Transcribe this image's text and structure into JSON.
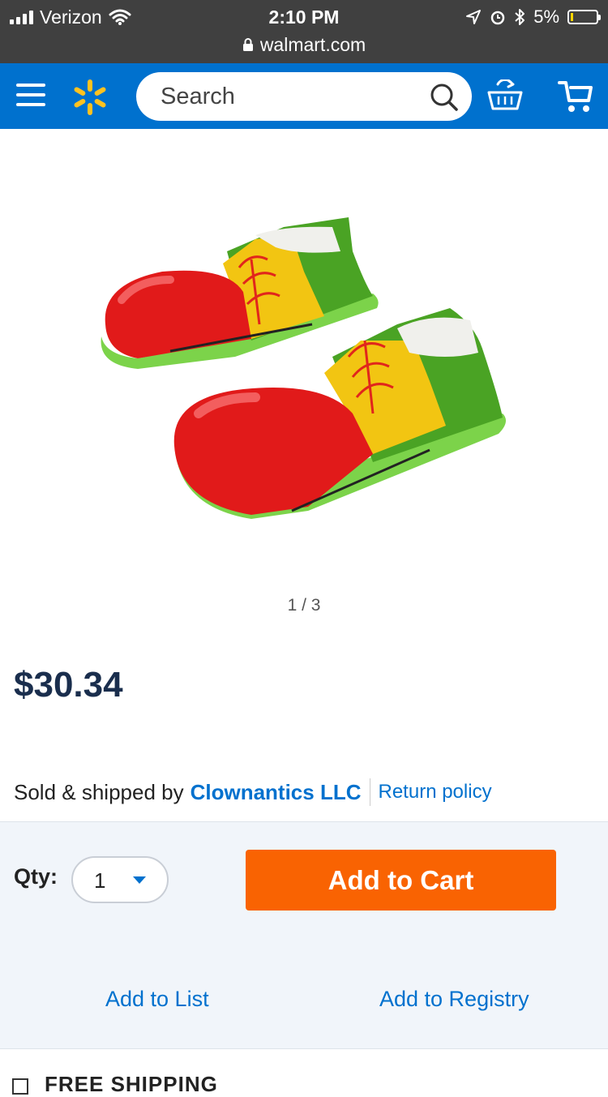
{
  "status_bar": {
    "carrier": "Verizon",
    "time": "2:10 PM",
    "battery": "5%",
    "url": "walmart.com"
  },
  "header": {
    "search_placeholder": "Search",
    "icons": [
      "menu-icon",
      "walmart-spark-logo",
      "search-icon",
      "reorder-basket-icon",
      "cart-icon"
    ],
    "brand_color": "#0071ce",
    "spark_color": "#ffc220"
  },
  "product": {
    "image_pager": "1 / 3",
    "price": "$30.34",
    "sold_by_prefix": "Sold & shipped by",
    "seller": "Clownantics LLC",
    "return_policy": "Return policy"
  },
  "actions": {
    "qty_label": "Qty:",
    "qty_value": "1",
    "add_to_cart": "Add to Cart",
    "add_to_list": "Add to List",
    "add_to_registry": "Add to Registry",
    "cart_button_color": "#f96302"
  },
  "shipping": {
    "label": "FREE SHIPPING"
  }
}
